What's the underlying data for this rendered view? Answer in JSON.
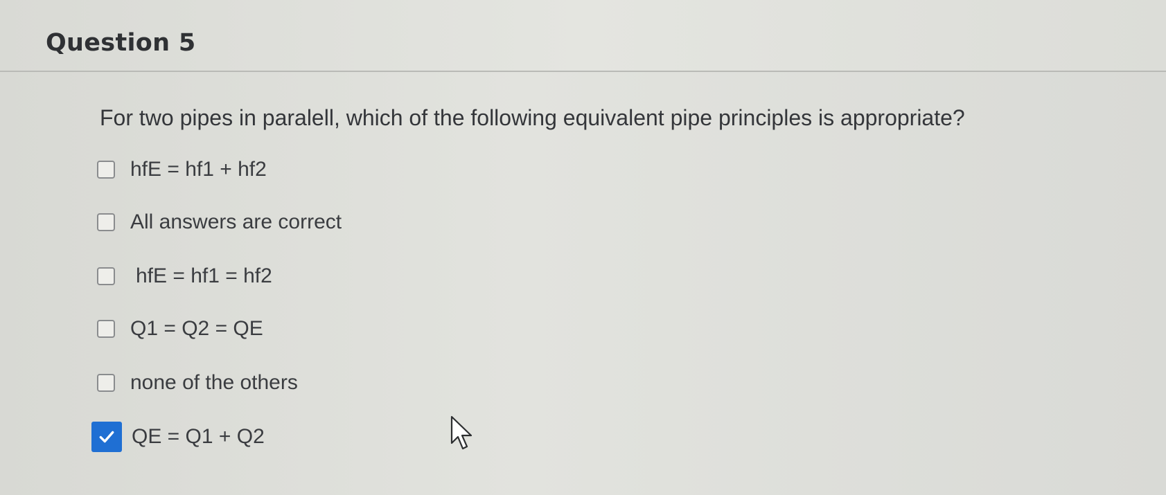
{
  "question": {
    "title": "Question 5",
    "text": "For two pipes in paralell, which of the following equivalent pipe principles is appropriate?",
    "options": [
      {
        "label": "hfE = hf1 + hf2",
        "checked": false
      },
      {
        "label": "All answers are correct",
        "checked": false
      },
      {
        "label": "hfE = hf1 = hf2",
        "checked": false
      },
      {
        "label": "Q1 = Q2 = QE",
        "checked": false
      },
      {
        "label": "none of the others",
        "checked": false
      },
      {
        "label": "QE = Q1 + Q2",
        "checked": true
      }
    ]
  },
  "colors": {
    "checked_box": "#1f6fd3",
    "background": "#dfe0db"
  },
  "icons": {
    "checkmark": "checkmark-icon",
    "cursor": "mouse-pointer-icon"
  }
}
